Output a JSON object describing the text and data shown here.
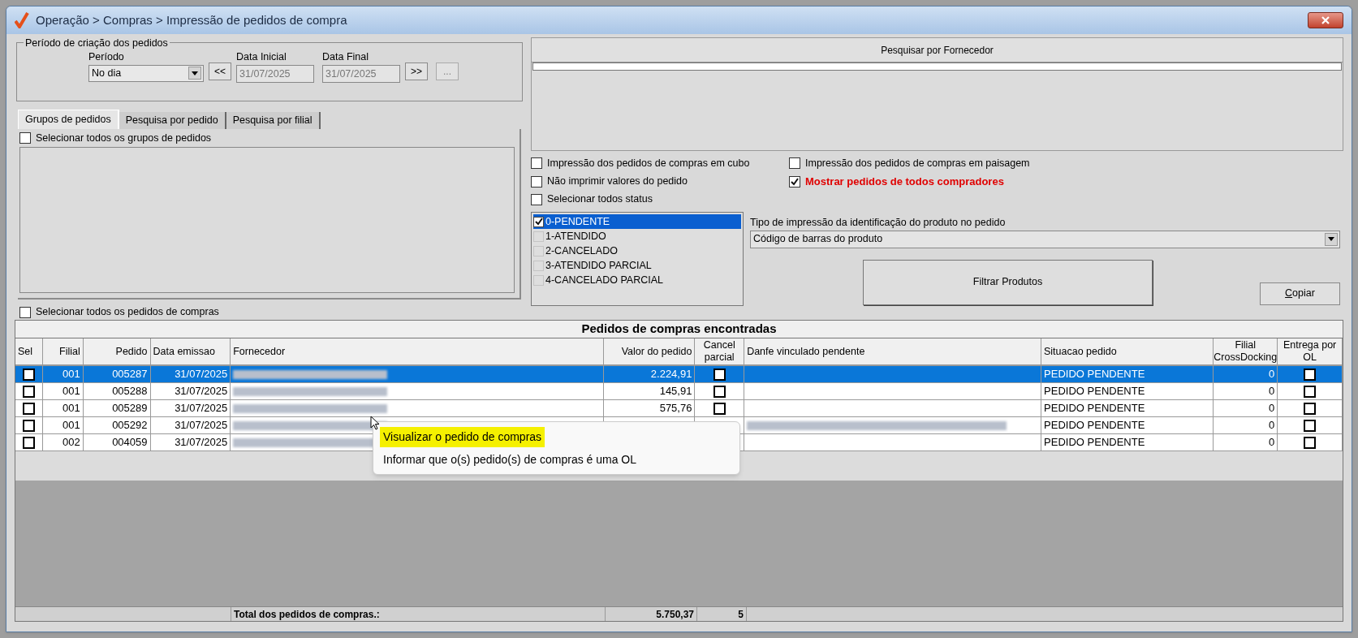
{
  "window": {
    "title": "Operação > Compras > Impressão de pedidos de compra"
  },
  "period_group": {
    "legend": "Período de criação dos pedidos",
    "periodo": {
      "label": "Período",
      "value": "No dia"
    },
    "prev_button": "<<",
    "data_inicial": {
      "label": "Data Inicial",
      "value": "31/07/2025",
      "disabled": true
    },
    "data_final": {
      "label": "Data Final",
      "value": "31/07/2025",
      "disabled": true
    },
    "next_button": ">>",
    "more_button": "..."
  },
  "tabs": [
    {
      "label": "Grupos de pedidos",
      "selected": true
    },
    {
      "label": "Pesquisa por pedido",
      "selected": false
    },
    {
      "label": "Pesquisa por filial",
      "selected": false
    }
  ],
  "select_all_groups": {
    "label": "Selecionar todos os grupos de pedidos",
    "checked": false
  },
  "select_all_orders": {
    "label": "Selecionar todos os pedidos de compras",
    "checked": false
  },
  "supplier_search": {
    "title": "Pesquisar por Fornecedor"
  },
  "options": [
    {
      "label": "Impressão dos pedidos de compras em cubo",
      "checked": false,
      "emphasized": false
    },
    {
      "label": "Impressão dos pedidos de compras em paisagem",
      "checked": false,
      "emphasized": false
    },
    {
      "label": "Não imprimir valores do pedido",
      "checked": false,
      "emphasized": false
    },
    {
      "label": "Mostrar pedidos de todos compradores",
      "checked": true,
      "emphasized": true
    }
  ],
  "select_all_status": {
    "label": "Selecionar todos status",
    "checked": false
  },
  "status_list": [
    {
      "label": "0-PENDENTE",
      "checked": true,
      "selected": true
    },
    {
      "label": "1-ATENDIDO",
      "checked": false,
      "selected": false
    },
    {
      "label": "2-CANCELADO",
      "checked": false,
      "selected": false
    },
    {
      "label": "3-ATENDIDO PARCIAL",
      "checked": false,
      "selected": false
    },
    {
      "label": "4-CANCELADO PARCIAL",
      "checked": false,
      "selected": false
    }
  ],
  "print_type": {
    "label": "Tipo de impressão da identificação do produto no pedido",
    "value": "Código de barras do produto"
  },
  "filter_button": "Filtrar Produtos",
  "copy_button": "Copiar",
  "table": {
    "title": "Pedidos de compras encontradas",
    "columns": [
      "Sel",
      "Filial",
      "Pedido",
      "Data emissao",
      "Fornecedor",
      "Valor do pedido",
      "Cancel parcial",
      "Danfe vinculado pendente",
      "Situacao pedido",
      "Filial CrossDocking",
      "Entrega por OL"
    ],
    "rows": [
      {
        "selected": true,
        "sel": false,
        "filial": "001",
        "pedido": "005287",
        "data": "31/07/2025",
        "valor": "2.224,91",
        "cancel": false,
        "danfe_redacted": false,
        "situacao": "PEDIDO PENDENTE",
        "crossdocking": "0",
        "entrega": false
      },
      {
        "selected": false,
        "sel": false,
        "filial": "001",
        "pedido": "005288",
        "data": "31/07/2025",
        "valor": "145,91",
        "cancel": false,
        "danfe_redacted": false,
        "situacao": "PEDIDO PENDENTE",
        "crossdocking": "0",
        "entrega": false
      },
      {
        "selected": false,
        "sel": false,
        "filial": "001",
        "pedido": "005289",
        "data": "31/07/2025",
        "valor": "575,76",
        "cancel": false,
        "danfe_redacted": false,
        "situacao": "PEDIDO PENDENTE",
        "crossdocking": "0",
        "entrega": false
      },
      {
        "selected": false,
        "sel": false,
        "filial": "001",
        "pedido": "005292",
        "data": "31/07/2025",
        "danfe_redacted": true,
        "situacao": "PEDIDO PENDENTE",
        "crossdocking": "0",
        "entrega": false
      },
      {
        "selected": false,
        "sel": false,
        "filial": "002",
        "pedido": "004059",
        "data": "31/07/2025",
        "danfe_redacted": false,
        "situacao": "PEDIDO PENDENTE",
        "crossdocking": "0",
        "entrega": false
      }
    ],
    "totals": {
      "label": "Total dos pedidos de compras.:",
      "valor": "5.750,37",
      "count": "5"
    }
  },
  "context_menu": {
    "items": [
      {
        "label": "Visualizar o pedido de compras",
        "highlighted": true
      },
      {
        "label": "Informar que o(s) pedido(s) de compras é uma OL",
        "highlighted": false
      }
    ]
  }
}
